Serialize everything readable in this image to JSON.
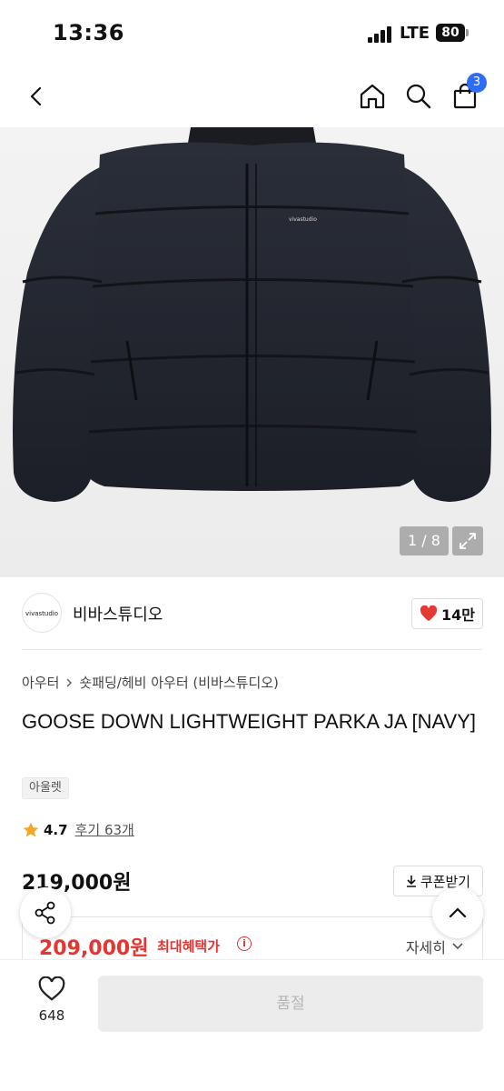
{
  "status": {
    "time": "13:36",
    "network": "LTE",
    "battery": "80"
  },
  "nav": {
    "cart_count": "3"
  },
  "gallery": {
    "counter": "1 / 8",
    "jacket_logo_text": "vivastudio"
  },
  "brand": {
    "logo_text": "vivastudio",
    "name": "비바스튜디오",
    "likes": "14만"
  },
  "breadcrumb": {
    "category": "아우터",
    "subcategory": "숏패딩/헤비 아우터 (비바스튜디오)"
  },
  "product": {
    "title": "GOOSE DOWN LIGHTWEIGHT PARKA JA [NAVY]",
    "badge": "아울렛",
    "rating": "4.7",
    "reviews": "후기 63개",
    "original_price": "219,000원",
    "coupon_label": "쿠폰받기",
    "sale_price": "209,000원",
    "max_benefit_label": "최대혜택가",
    "detail_label": "자세히"
  },
  "bottom": {
    "wish_count": "648",
    "soldout_label": "품절"
  },
  "colors": {
    "accent_red": "#e8342f",
    "badge_blue": "#2f6cf6",
    "heart_red": "#e53935",
    "star_yellow": "#f5a623"
  }
}
